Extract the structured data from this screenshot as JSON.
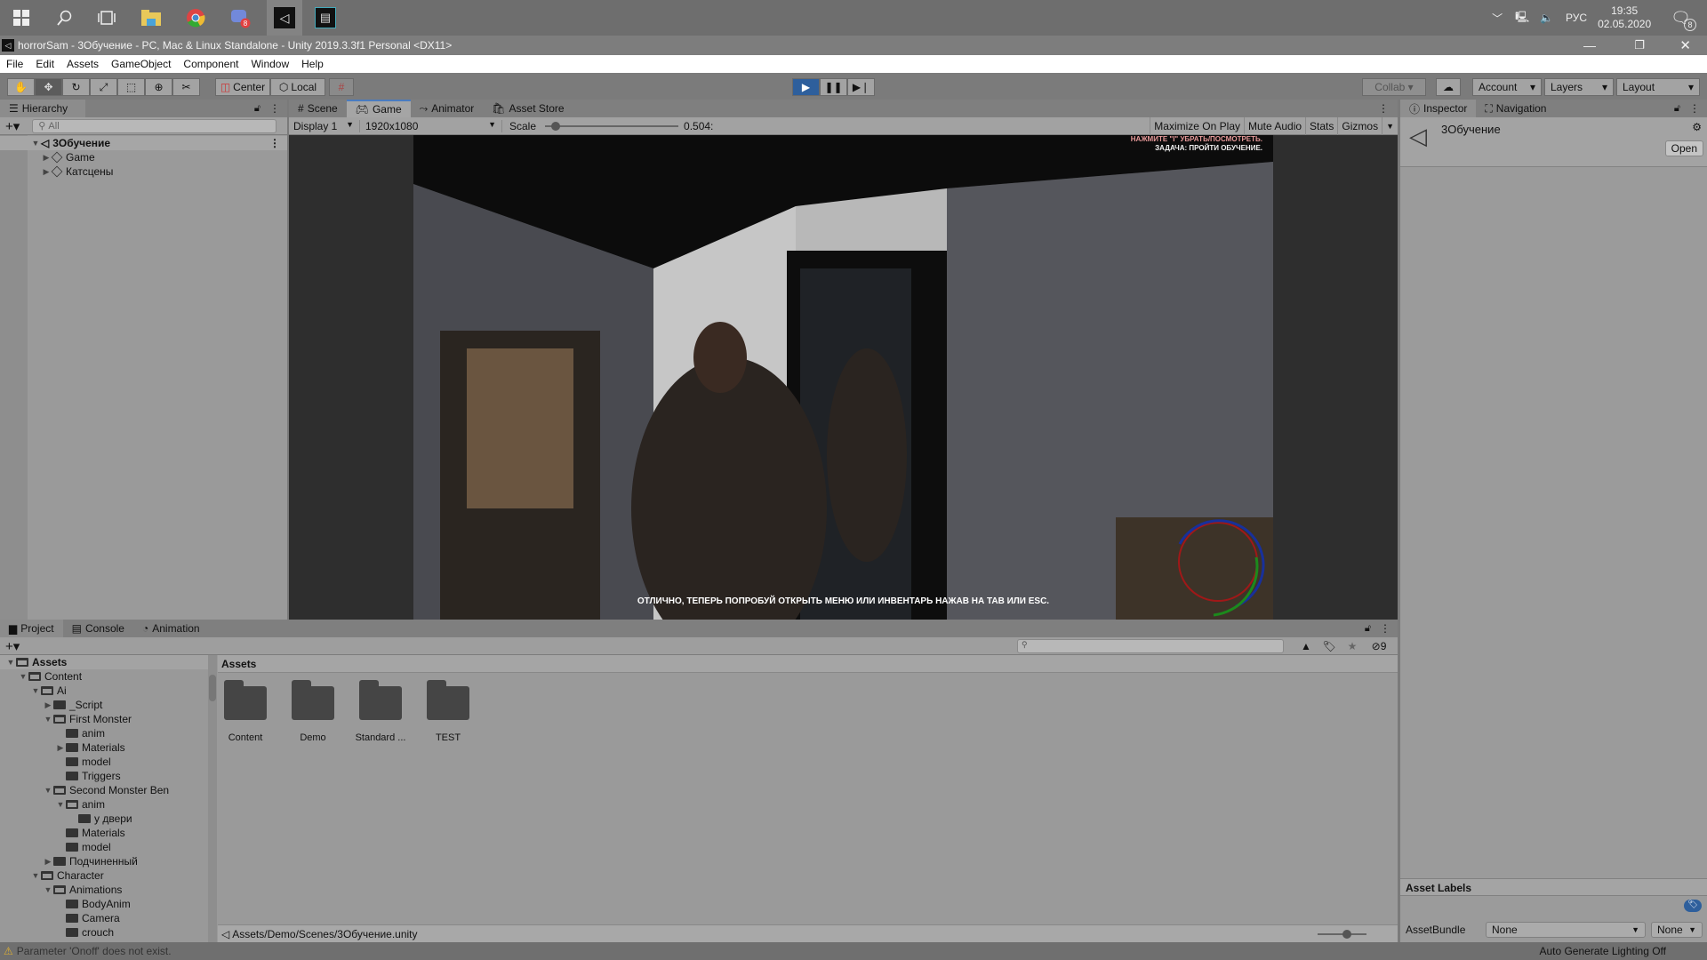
{
  "taskbar": {
    "icons": [
      "windows-start-icon",
      "search-icon",
      "task-view-icon",
      "file-explorer-icon",
      "chrome-icon",
      "discord-icon",
      "unity-icon",
      "film-editor-icon"
    ],
    "discord_badge": "8",
    "tray": {
      "language": "РУС",
      "time": "19:35",
      "date": "02.05.2020",
      "notification_count": "8"
    }
  },
  "window": {
    "title": "horrorSam - 3Обучение - PC, Mac & Linux Standalone - Unity 2019.3.3f1 Personal <DX11>"
  },
  "menu": [
    "File",
    "Edit",
    "Assets",
    "GameObject",
    "Component",
    "Window",
    "Help"
  ],
  "toolbar": {
    "pivot": "Center",
    "space": "Local",
    "collab": "Collab",
    "account": "Account",
    "layers": "Layers",
    "layout": "Layout"
  },
  "hierarchy": {
    "tab": "Hierarchy",
    "search_placeholder": "All",
    "scene": "3Обучение",
    "objects": [
      "Game",
      "Катсцены"
    ]
  },
  "center_tabs": [
    "Scene",
    "Game",
    "Animator",
    "Asset Store"
  ],
  "game_bar": {
    "display": "Display 1",
    "resolution": "1920x1080",
    "scale_label": "Scale",
    "scale_value": "0.504:",
    "scale_fraction": 0.05,
    "buttons": [
      "Maximize On Play",
      "Mute Audio",
      "Stats",
      "Gizmos"
    ]
  },
  "game_view": {
    "hud_hint": "НАЖМИТЕ \"I\" УБРАТЬ/ПОСМОТРЕТЬ.",
    "hud_task": "ЗАДАЧА: ПРОЙТИ ОБУЧЕНИЕ.",
    "subtitle": "ОТЛИЧНО, ТЕПЕРЬ ПОПРОБУЙ ОТКРЫТЬ МЕНЮ ИЛИ ИНВЕНТАРЬ НАЖАВ НА TAB ИЛИ ESC."
  },
  "inspector": {
    "tabs": [
      "Inspector",
      "Navigation"
    ],
    "object_name": "3Обучение",
    "open_button": "Open",
    "asset_labels": "Asset Labels",
    "asset_bundle_label": "AssetBundle",
    "asset_bundle_value": "None",
    "asset_bundle_variant": "None"
  },
  "bottom_tabs": [
    "Project",
    "Console",
    "Animation"
  ],
  "project": {
    "hidden_count": "9",
    "tree": [
      {
        "label": "Assets",
        "depth": 0,
        "arrow": "down",
        "open": true,
        "bold": true
      },
      {
        "label": "Content",
        "depth": 1,
        "arrow": "down",
        "open": true
      },
      {
        "label": "Ai",
        "depth": 2,
        "arrow": "down",
        "open": true
      },
      {
        "label": "_Script",
        "depth": 3,
        "arrow": "right",
        "open": false
      },
      {
        "label": "First Monster",
        "depth": 3,
        "arrow": "down",
        "open": true
      },
      {
        "label": "anim",
        "depth": 4,
        "arrow": "",
        "open": false
      },
      {
        "label": "Materials",
        "depth": 4,
        "arrow": "right",
        "open": false
      },
      {
        "label": "model",
        "depth": 4,
        "arrow": "",
        "open": false
      },
      {
        "label": "Triggers",
        "depth": 4,
        "arrow": "",
        "open": false
      },
      {
        "label": "Second Monster Ben",
        "depth": 3,
        "arrow": "down",
        "open": true
      },
      {
        "label": "anim",
        "depth": 4,
        "arrow": "down",
        "open": true
      },
      {
        "label": "у двери",
        "depth": 5,
        "arrow": "",
        "open": false
      },
      {
        "label": "Materials",
        "depth": 4,
        "arrow": "",
        "open": false
      },
      {
        "label": "model",
        "depth": 4,
        "arrow": "",
        "open": false
      },
      {
        "label": "Подчиненный",
        "depth": 3,
        "arrow": "right",
        "open": false
      },
      {
        "label": "Character",
        "depth": 2,
        "arrow": "down",
        "open": true
      },
      {
        "label": "Animations",
        "depth": 3,
        "arrow": "down",
        "open": true
      },
      {
        "label": "BodyAnim",
        "depth": 4,
        "arrow": "",
        "open": false
      },
      {
        "label": "Camera",
        "depth": 4,
        "arrow": "",
        "open": false
      },
      {
        "label": "crouch",
        "depth": 4,
        "arrow": "",
        "open": false
      }
    ],
    "breadcrumb": "Assets",
    "folders": [
      "Content",
      "Demo",
      "Standard ...",
      "TEST"
    ],
    "selected_path": "Assets/Demo/Scenes/3Обучение.unity"
  },
  "status": {
    "warning": "Parameter 'Onoff' does not exist.",
    "right": "Auto Generate Lighting Off"
  }
}
